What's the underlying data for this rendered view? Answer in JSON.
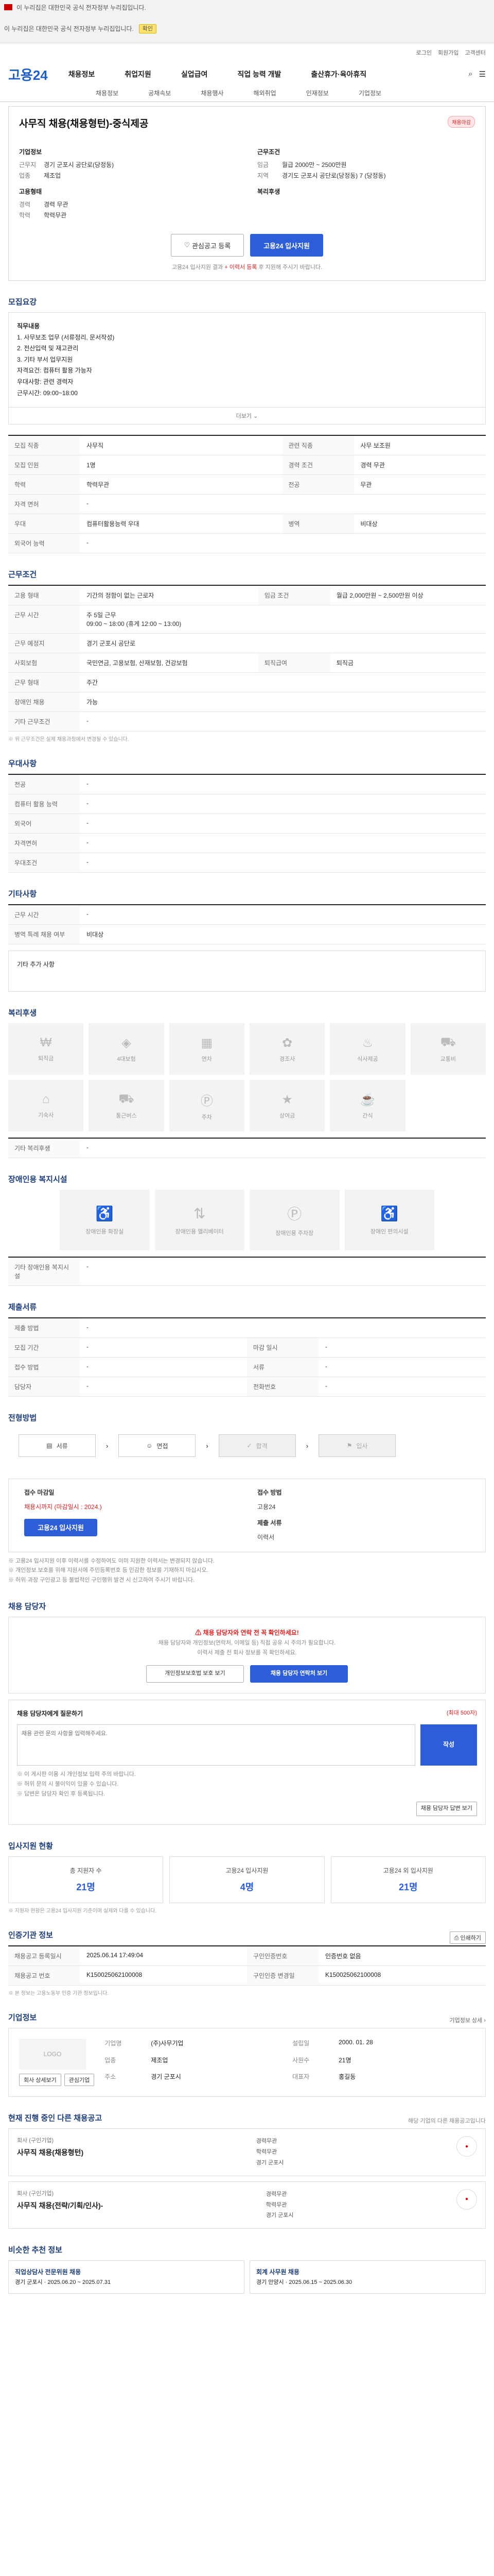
{
  "topbar": {
    "notice": "이 누리집은 대한민국 공식 전자정부 누리집입니다.",
    "toggle": "확인"
  },
  "topbar2": {
    "text": "이 누리집은 대한민국 공식 전자정부 누리집입니다.",
    "btn": "확인"
  },
  "util": [
    "로그인",
    "회원가입",
    "고객센터"
  ],
  "gnb": {
    "logo": "고용24",
    "menu": [
      "채용정보",
      "취업지원",
      "실업급여",
      "직업 능력 개발",
      "출산휴가·육아휴직"
    ]
  },
  "lnb": [
    "채용정보",
    "공채속보",
    "채용행사",
    "해외취업",
    "인재정보",
    "기업정보"
  ],
  "job": {
    "title": "사무직 채용(채용형턴)-중식제공",
    "badge": "채용마감",
    "company_label": "기업정보",
    "company_name": "회사명",
    "loc_label": "근무지",
    "loc_value": "경기 군포시 공단로(당정동)",
    "biz_label": "업종",
    "biz_value": "제조업",
    "cond_label": "근무조건",
    "wage_label": "임금",
    "wage_value": "월급 2000만 ~ 2500만원",
    "area_label": "지역",
    "area_value": "경기도 군포시 공단로(당정동) 7 (당정동)",
    "req_label": "고용형태",
    "career_k": "경력",
    "career_v": "경력 무관",
    "edu_k": "학력",
    "edu_v": "학력무관",
    "work_label": "복리후생",
    "btn_interest": "관심공고 등록",
    "btn_apply": "고용24 입사지원",
    "note_prefix": "고용24 입사지원 결과 ",
    "note_red": "+ 이력서 등록",
    "note_suffix": " 후 지원해 주시기 바랍니다."
  },
  "recruit": {
    "title": "모집요강",
    "lines": [
      "직무내용",
      "1. 사무보조 업무 (서류정리, 문서작성)",
      "2. 전산입력 및 재고관리",
      "3. 기타 부서 업무지원",
      "자격요건: 컴퓨터 활용 가능자",
      "우대사항: 관련 경력자",
      "근무시간: 09:00~18:00"
    ],
    "more": "더보기"
  },
  "req_table": [
    [
      "모집 직종",
      "사무직",
      "관련 직종",
      "사무 보조원"
    ],
    [
      "모집 인원",
      "1명",
      "경력 조건",
      "경력 무관"
    ],
    [
      "학력",
      "학력무관",
      "전공",
      "무관"
    ],
    [
      "자격 면허",
      "-",
      "",
      ""
    ],
    [
      "우대",
      "컴퓨터활용능력 우대",
      "병역",
      "비대상"
    ],
    [
      "외국어 능력",
      "-",
      "",
      ""
    ]
  ],
  "work": {
    "title": "근무조건",
    "rows": [
      [
        "고용 형태",
        "기간의 정함이 없는 근로자",
        "임금 조건",
        "월급 2,000만원 ~ 2,500만원 이상"
      ],
      [
        "",
        "",
        "",
        ""
      ],
      [
        "근무 시간",
        "주 5일 근무",
        "",
        ""
      ],
      [
        "",
        "09:00 ~ 18:00 (휴게 12:00 ~ 13:00)",
        "",
        ""
      ],
      [
        "근무 예정지",
        "경기 군포시 공단로",
        "",
        ""
      ],
      [
        "사회보험",
        "국민연금, 고용보험, 산재보험, 건강보험",
        "퇴직급여",
        "퇴직금"
      ],
      [
        "근무 형태",
        "주간",
        "",
        ""
      ],
      [
        "장애인 채용",
        "가능",
        "",
        ""
      ],
      [
        "기타 근무조건",
        "-",
        "",
        ""
      ]
    ],
    "foot": "※ 위 근무조건은 실제 채용과정에서 변경될 수 있습니다."
  },
  "prefer": {
    "title": "우대사항",
    "rows": [
      [
        "전공",
        "-"
      ],
      [
        "컴퓨터 활용 능력",
        "-"
      ],
      [
        "외국어",
        "-"
      ],
      [
        "자격면허",
        "-"
      ],
      [
        "우대조건",
        "-"
      ]
    ]
  },
  "other": {
    "title": "기타사항",
    "rows": [
      [
        "근무 시간",
        "-"
      ],
      [
        "병역 특례 채용 여부",
        "비대상"
      ]
    ],
    "note": "기타 추가 사항"
  },
  "welfare": {
    "title": "복리후생",
    "items": [
      "퇴직금",
      "4대보험",
      "연차",
      "경조사",
      "식사제공",
      "교통비",
      "기숙사",
      "통근버스",
      "주차",
      "상여금",
      "간식"
    ],
    "note_k": "기타 복리후생",
    "note_v": "-"
  },
  "disability": {
    "title": "장애인용 복지시설",
    "items": [
      "장애인용 화장실",
      "장애인용 엘리베이터",
      "장애인용 주차장",
      "장애인 편의시설"
    ],
    "note_k": "기타 장애인용 복지시설",
    "note_v": "-"
  },
  "apply_doc": {
    "title": "제출서류",
    "rows": [
      [
        "제출 방법",
        "-",
        "",
        ""
      ],
      [
        "모집 기간",
        "-",
        "마감 일시",
        "-"
      ],
      [
        "접수 방법",
        "-",
        "서류",
        "-"
      ],
      [
        "담당자",
        "-",
        "전화번호",
        "-"
      ]
    ]
  },
  "process": {
    "title": "전형방법",
    "steps": [
      "서류",
      "면접",
      "합격",
      "입사"
    ]
  },
  "applyinfo": {
    "deadline_k": "접수 마감일",
    "deadline_v": "채용시까지 (마감일시 : 2024.)",
    "method_k": "접수 방법",
    "method_v": "고용24",
    "docs_k": "제출 서류",
    "docs_v": "이력서",
    "apply_btn": "고용24 입사지원",
    "notes": [
      "※ 고용24 입사지원 이후 이력서를 수정하여도 이미 지원한 이력서는 변경되지 않습니다.",
      "※ 개인정보 보호를 위해 지원서에 주민등록번호 등 민감한 정보를 기재하지 마십시오.",
      "※ 허위·과장 구인광고 등 불법적인 구인행위 발견 시 신고하여 주시기 바랍니다."
    ]
  },
  "contact": {
    "title": "채용 담당자",
    "hi": "채용 담당자와 연락 전 꼭 확인하세요!",
    "line1": "채용 담당자와 개인정보(연락처, 이메일 등) 직접 공유 시 주의가 필요합니다.",
    "line2": "이력서 제출 전 회사 정보를 꼭 확인하세요.",
    "btn1": "개인정보보호법 보호 보기",
    "btn2": "채용 담당자 연락처 보기",
    "q_title": "채용 담당자에게 질문하기",
    "q_hint": "(최대 500자)",
    "q_placeholder": "채용 관련 문의 사항을 입력해주세요.",
    "q_btn": "작성",
    "bullets": [
      "※ 이 게시판 이용 시 개인정보 입력 주의 바랍니다.",
      "※ 허위 문의 시 불이익이 있을 수 있습니다.",
      "※ 답변은 담당자 확인 후 등록됩니다."
    ],
    "cta": "채용 담당자 답변 보기"
  },
  "status": {
    "title": "입사지원 현황",
    "cards": [
      {
        "k": "총 지원자 수",
        "v": "21명"
      },
      {
        "k": "고용24 입사지원",
        "v": "4명"
      },
      {
        "k": "고용24 외 입사지원",
        "v": "21명"
      }
    ],
    "foot": "※ 지원자 현황은 고용24 입사지원 기준이며 실제와 다를 수 있습니다."
  },
  "info": {
    "title": "인증기관 정보",
    "print": "인쇄하기",
    "rows": [
      [
        "채용공고 등록일시",
        "2025.06.14 17:49:04",
        "구인인증번호",
        "인증번호 없음"
      ],
      [
        "채용공고 번호",
        "K150025062100008",
        "구인인증 변경일",
        "K150025062100008"
      ]
    ],
    "note": "※ 본 정보는 고용노동부 인증 기관 정보입니다."
  },
  "company": {
    "title": "기업정보",
    "detail": "기업정보 상세 ›",
    "logo": "LOGO",
    "k1": "기업명",
    "v1": "(주)사무기업",
    "k2": "설립일",
    "v2": "2000. 01. 28",
    "k3": "업종",
    "v3": "제조업",
    "k4": "사원수",
    "v4": "21명",
    "k5": "주소",
    "v5": "경기 군포시",
    "k6": "대표자",
    "v6": "홍길동",
    "btn1": "회사 상세보기",
    "btn2": "관심기업"
  },
  "recent": {
    "title": "현재 진행 중인 다른 채용공고",
    "note": "해당 기업의 다른 채용공고입니다",
    "items": [
      {
        "org": "회사 (구인기업)",
        "tt": "사무직 채용(채용형턴)",
        "meta": [
          "경력무관",
          "학력무관",
          "경기 군포시"
        ]
      },
      {
        "org": "회사 (구인기업)",
        "tt": "사무직 채용(전략/기획/인사)-",
        "meta": [
          "경력무관",
          "학력무관",
          "경기 군포시"
        ]
      }
    ]
  },
  "similar": {
    "title": "비슷한 추천 정보",
    "items": [
      {
        "tt": "직업상담사 전문위원 채용",
        "d": "경기 군포시 · 2025.06.20 ~ 2025.07.31"
      },
      {
        "tt": "회계 사무원 채용",
        "d": "경기 안양시 · 2025.06.15 ~ 2025.06.30"
      }
    ]
  }
}
